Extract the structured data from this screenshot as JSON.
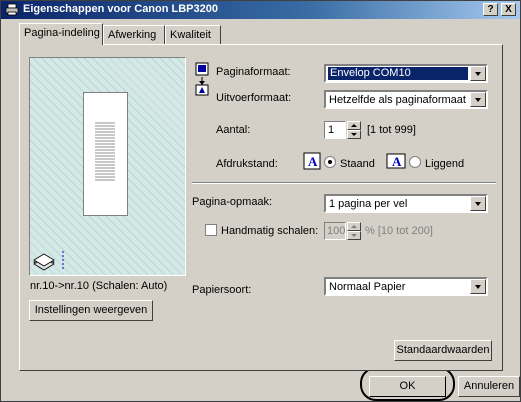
{
  "window": {
    "title": "Eigenschappen voor Canon LBP3200",
    "help_label": "?",
    "close_label": "X"
  },
  "tabs": [
    {
      "label": "Pagina-indeling",
      "active": true
    },
    {
      "label": "Afwerking",
      "active": false
    },
    {
      "label": "Kwaliteit",
      "active": false
    }
  ],
  "preview": {
    "caption": "nr.10->nr.10 (Schalen: Auto)",
    "show_settings_label": "Instellingen weergeven"
  },
  "fields": {
    "page_size": {
      "label": "Paginaformaat:",
      "value": "Envelop COM10"
    },
    "output_size": {
      "label": "Uitvoerformaat:",
      "value": "Hetzelfde als paginaformaat"
    },
    "copies": {
      "label": "Aantal:",
      "value": "1",
      "range": "[1 tot 999]"
    },
    "orientation": {
      "label": "Afdrukstand:",
      "portrait": "Staand",
      "landscape": "Liggend",
      "selected": "Staand"
    },
    "page_layout": {
      "label": "Pagina-opmaak:",
      "value": "1 pagina per vel"
    },
    "manual_scaling": {
      "label": "Handmatig schalen:",
      "value": "100",
      "range": "% [10 tot 200]",
      "checked": false
    },
    "paper_type": {
      "label": "Papiersoort:",
      "value": "Normaal Papier"
    }
  },
  "buttons": {
    "defaults": "Standaardwaarden",
    "ok": "OK",
    "cancel": "Annuleren"
  }
}
